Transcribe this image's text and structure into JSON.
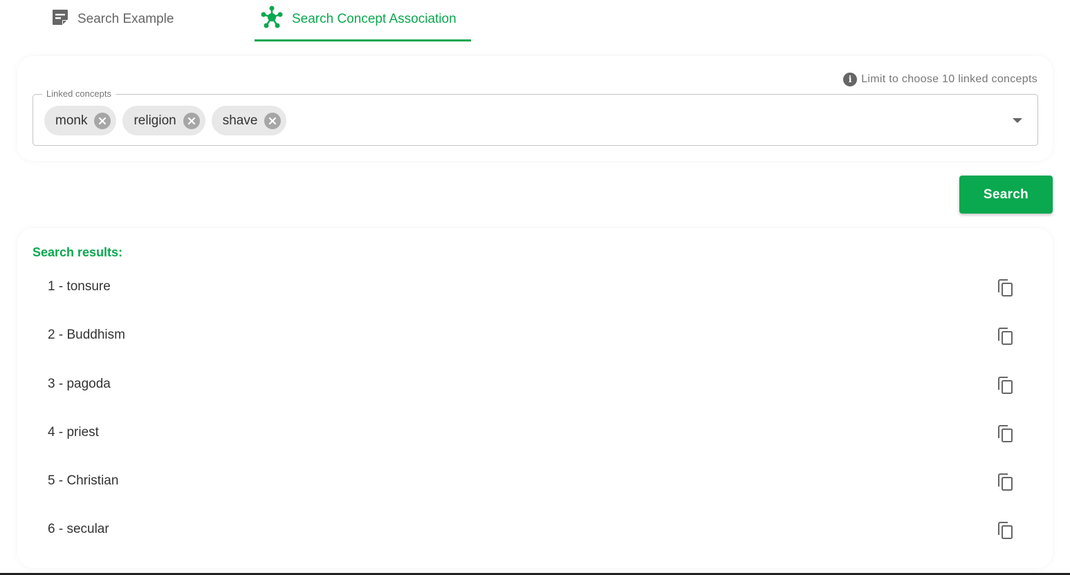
{
  "tabs": [
    {
      "label": "Search Example",
      "icon": "note-icon",
      "active": false
    },
    {
      "label": "Search Concept Association",
      "icon": "network-icon",
      "active": true
    }
  ],
  "input_card": {
    "limit_note": "Limit to choose 10 linked concepts",
    "field_label": "Linked concepts",
    "chips": [
      "monk",
      "religion",
      "shave"
    ]
  },
  "search_button": {
    "label": "Search"
  },
  "results": {
    "title": "Search results:",
    "items": [
      "1 - tonsure",
      "2 - Buddhism",
      "3 - pagoda",
      "4 - priest",
      "5 - Christian",
      "6 - secular"
    ]
  },
  "colors": {
    "accent": "#0aa84f",
    "inactive_text": "#666666",
    "chip_bg": "#e8e8e8"
  }
}
